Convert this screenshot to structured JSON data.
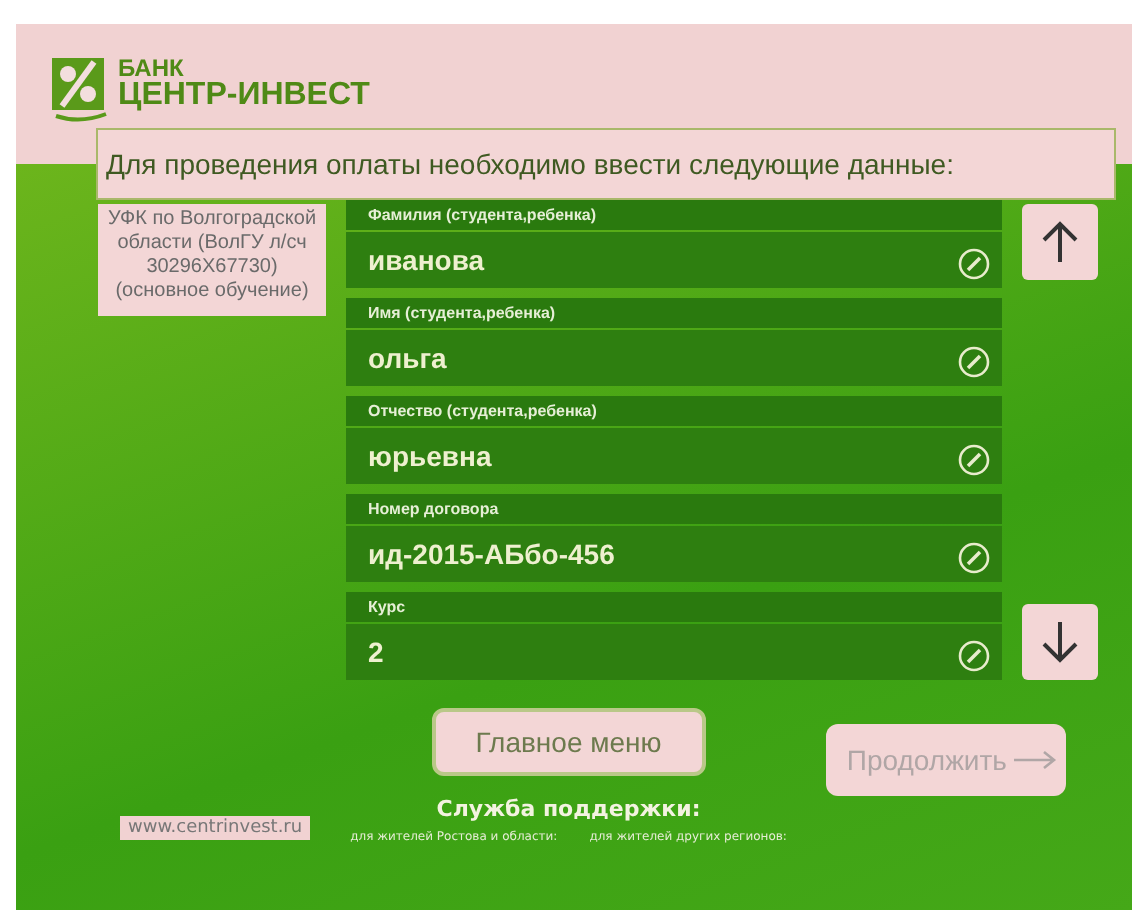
{
  "logo": {
    "line1": "БАНК",
    "line2": "ЦЕНТР-ИНВЕСТ"
  },
  "prompt": "Для проведения оплаты необходимо ввести следующие данные:",
  "recipient": "УФК по Волгоградской области (ВолГУ л/сч 30296Х67730) (основное обучение)",
  "fields": [
    {
      "label": "Фамилия (студента,ребенка)",
      "value": "иванова"
    },
    {
      "label": "Имя (студента,ребенка)",
      "value": "ольга"
    },
    {
      "label": "Отчество (студента,ребенка)",
      "value": "юрьевна"
    },
    {
      "label": "Номер договора",
      "value": "ид-2015-АБбо-456"
    },
    {
      "label": "Курс",
      "value": "2"
    }
  ],
  "main_menu_button": "Главное меню",
  "continue_button": {
    "label": "Продолжить",
    "disabled": true
  },
  "support": {
    "title": "Служба поддержки:",
    "rostov_caption": "для жителей Ростова и области:",
    "other_caption": "для жителей других регионов:"
  },
  "website": "www.centrinvest.ru"
}
